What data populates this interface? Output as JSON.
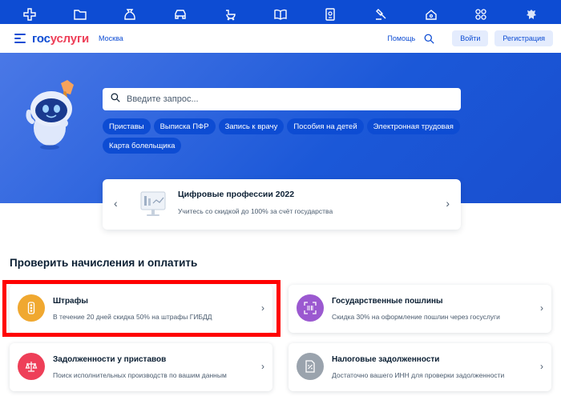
{
  "top_categories": [
    {
      "icon": "medical-cross-icon"
    },
    {
      "icon": "folder-icon"
    },
    {
      "icon": "money-bag-icon"
    },
    {
      "icon": "car-icon"
    },
    {
      "icon": "stroller-icon"
    },
    {
      "icon": "book-icon"
    },
    {
      "icon": "passport-icon"
    },
    {
      "icon": "court-hammer-icon"
    },
    {
      "icon": "house-icon"
    },
    {
      "icon": "grid-icon"
    },
    {
      "icon": "emblem-icon"
    }
  ],
  "header": {
    "logo_part1": "гос",
    "logo_part2": "услуги",
    "region": "Москва",
    "help": "Помощь",
    "login": "Войти",
    "register": "Регистрация"
  },
  "search": {
    "placeholder": "Введите запрос..."
  },
  "chips": [
    "Приставы",
    "Выписка ПФР",
    "Запись к врачу",
    "Пособия на детей",
    "Электронная трудовая",
    "Карта болельщика"
  ],
  "promo": {
    "title": "Цифровые профессии 2022",
    "subtitle": "Учитесь со скидкой до 100% за счёт государства"
  },
  "section": {
    "title": "Проверить начисления и оплатить"
  },
  "cards": [
    {
      "title": "Штрафы",
      "subtitle": "В течение 20 дней скидка 50% на штрафы ГИБДД",
      "icon": "traffic-light-icon",
      "color": "#f0a830"
    },
    {
      "title": "Государственные пошлины",
      "subtitle": "Скидка 30% на оформление пошлин через госуслуги",
      "icon": "barcode-scan-icon",
      "color": "#9b59d0"
    },
    {
      "title": "Задолженности у приставов",
      "subtitle": "Поиск исполнительных производств по вашим данным",
      "icon": "scales-icon",
      "color": "#ee3f58"
    },
    {
      "title": "Налоговые задолженности",
      "subtitle": "Достаточно вашего ИНН для проверки задолженности",
      "icon": "tax-document-icon",
      "color": "#9aa3ad"
    }
  ],
  "colors": {
    "brand_blue": "#0d4cd3",
    "brand_red": "#ee3f58",
    "highlight": "#ff0000"
  }
}
